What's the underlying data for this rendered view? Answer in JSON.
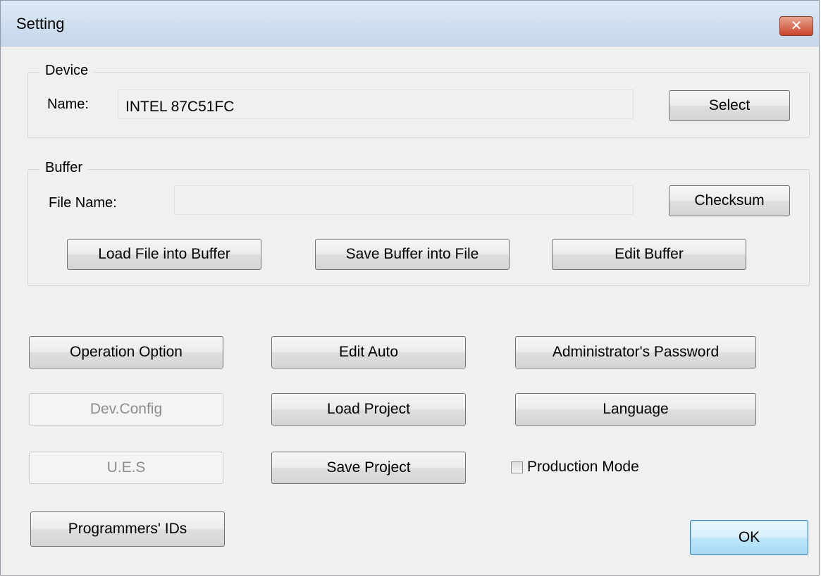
{
  "window": {
    "title": "Setting",
    "close_glyph": "✕"
  },
  "device": {
    "group_label": "Device",
    "name_label": "Name:",
    "name_value": "INTEL 87C51FC",
    "select_label": "Select"
  },
  "buffer": {
    "group_label": "Buffer",
    "file_name_label": "File Name:",
    "file_name_value": "",
    "checksum_label": "Checksum",
    "load_file_label": "Load File into Buffer",
    "save_buffer_label": "Save Buffer into File",
    "edit_buffer_label": "Edit Buffer"
  },
  "actions": {
    "operation_option": "Operation Option",
    "edit_auto": "Edit Auto",
    "admin_password": "Administrator's Password",
    "dev_config": "Dev.Config",
    "load_project": "Load Project",
    "language": "Language",
    "ues": "U.E.S",
    "save_project": "Save Project",
    "production_mode": "Production Mode",
    "production_mode_checked": false,
    "programmers_ids": "Programmers' IDs",
    "ok": "OK"
  }
}
